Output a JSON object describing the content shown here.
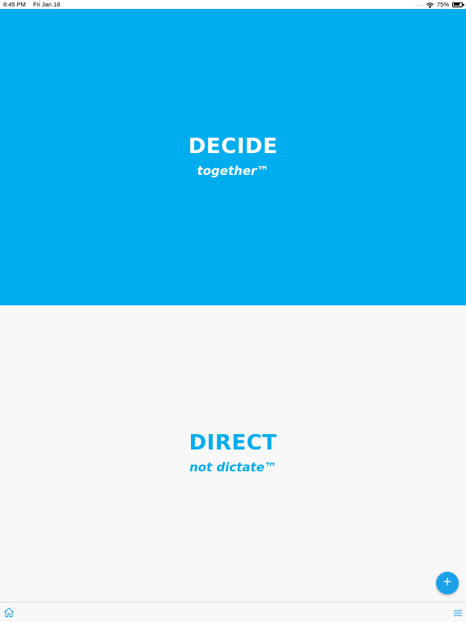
{
  "status_bar": {
    "time": "8:45 PM",
    "date": "Fri Jan 18",
    "dots": "....",
    "battery_percent": "75%",
    "battery_level": 0.75,
    "icons": [
      "wifi-icon",
      "battery-icon"
    ]
  },
  "top_panel": {
    "headline": "DECIDE",
    "tagline": "together™",
    "background_color": "#00adee",
    "text_color": "#ffffff"
  },
  "bottom_panel": {
    "headline": "DIRECT",
    "tagline": "not dictate™",
    "background_color": "#f8f8f8",
    "text_color": "#00adee"
  },
  "fab": {
    "icon": "plus-icon",
    "color": "#1ba1ea"
  },
  "bottom_bar": {
    "left_icon": "home-icon",
    "right_icon": "menu-icon",
    "icon_color": "#1ba1ea"
  }
}
